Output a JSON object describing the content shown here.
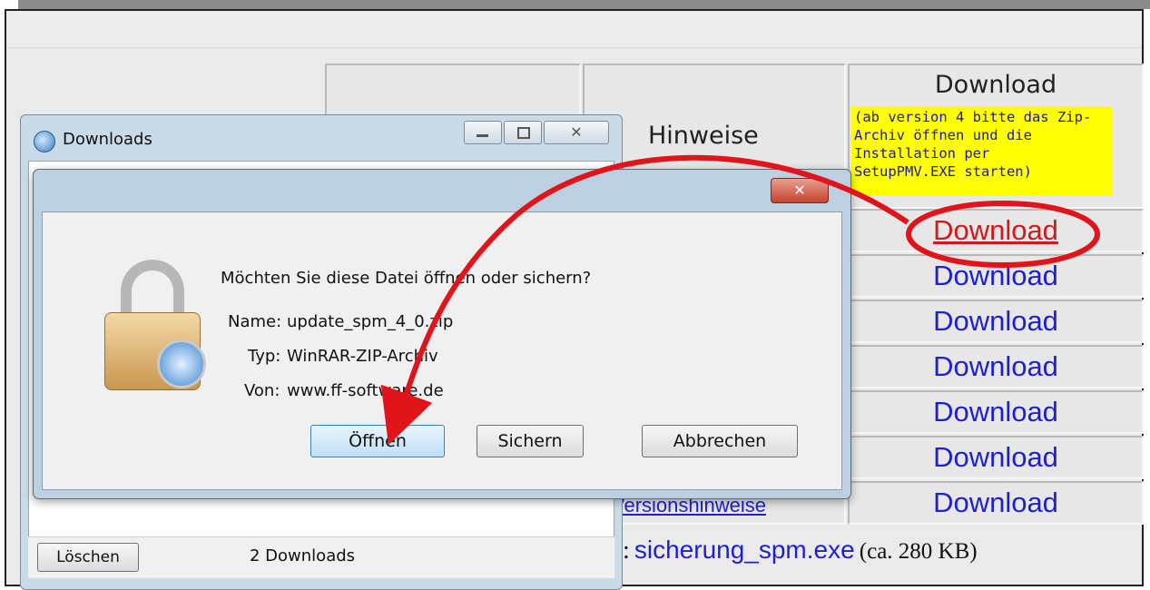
{
  "table": {
    "header_hinweise": "Hinweise",
    "header_download": "Download",
    "note": "(ab version 4 bitte das Zip-\nArchiv öffnen und die\nInstallation per\nSetupPMV.EXE starten)",
    "download_links": [
      "Download",
      "Download",
      "Download",
      "Download",
      "Download",
      "Download",
      "Download"
    ],
    "versions_link": "Versionshinweise",
    "footer_prefix": ":",
    "footer_link": "sicherung_spm.exe",
    "footer_size": "(ca. 280 KB)"
  },
  "downloads_window": {
    "title": "Downloads",
    "clear_button": "Löschen",
    "count_label": "2 Downloads"
  },
  "dialog": {
    "question": "Möchten Sie diese Datei öffnen oder sichern?",
    "name_label": "Name:",
    "name_value": "update_spm_4_0.zip",
    "type_label": "Typ:",
    "type_value": "WinRAR-ZIP-Archiv",
    "from_label": "Von:",
    "from_value": "www.ff-software.de",
    "open_button": "Öffnen",
    "save_button": "Sichern",
    "cancel_button": "Abbrechen"
  },
  "colors": {
    "link_blue": "#1f1fd2",
    "link_highlight_red": "#d01919",
    "annotation_red": "#e0141a",
    "note_yellow": "#ffff00"
  },
  "annotations": {
    "highlight": "red-circle-around-download",
    "arrow": "red-arrow-to-open-button"
  }
}
